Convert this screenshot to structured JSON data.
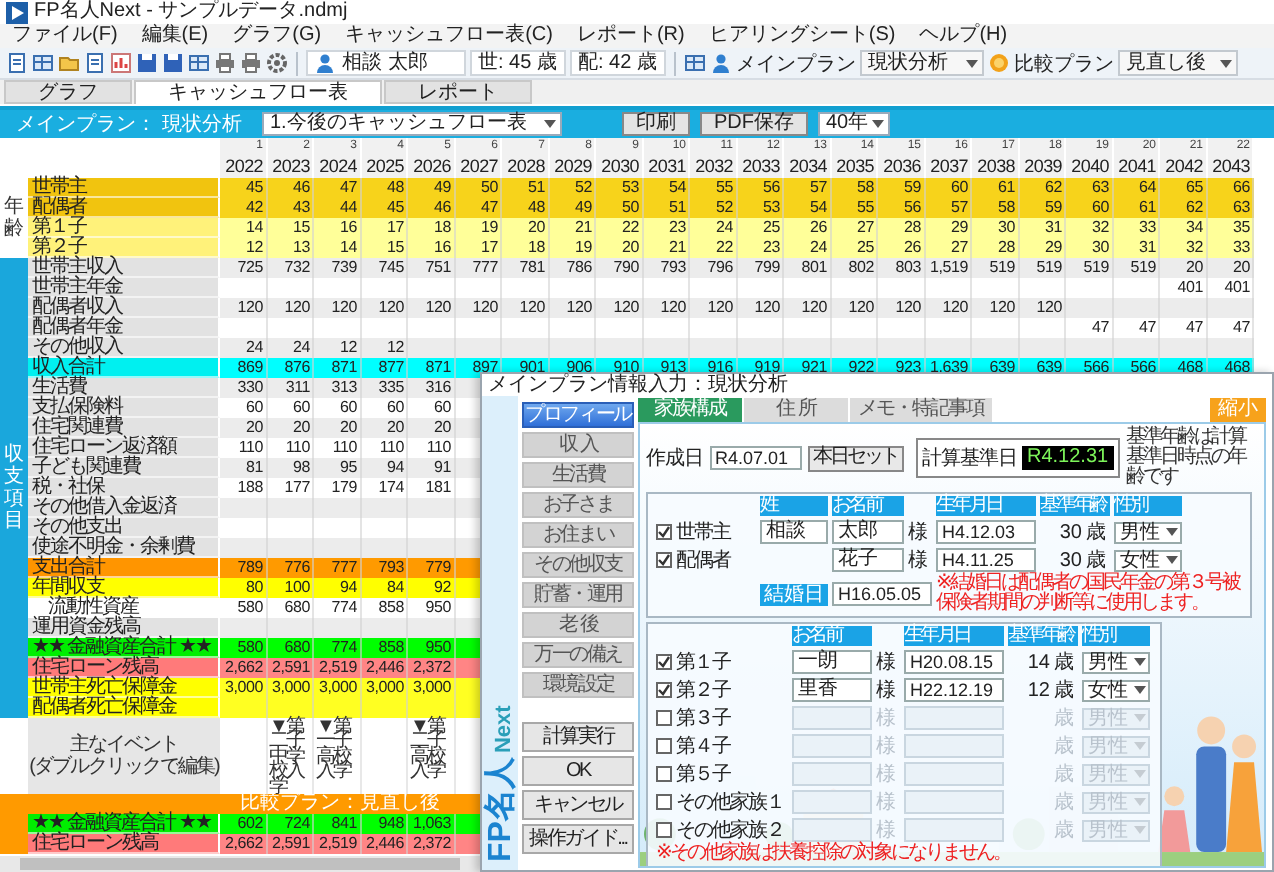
{
  "window": {
    "title": "FP名人Next - サンプルデータ.ndmj"
  },
  "menu": [
    "ファイル(F)",
    "編集(E)",
    "グラフ(G)",
    "キャッシュフロー表(C)",
    "レポート(R)",
    "ヒアリングシート(S)",
    "ヘルプ(H)"
  ],
  "toolbar": {
    "client": "相談 太郎",
    "head": {
      "label": "世:",
      "age": "45",
      "unit": "歳"
    },
    "spouse": {
      "label": "配:",
      "age": "42",
      "unit": "歳"
    },
    "main_plan": {
      "label": "メインプラン",
      "value": "現状分析"
    },
    "compare_plan": {
      "label": "比較プラン",
      "value": "見直し後"
    }
  },
  "tabs": [
    {
      "label": "グラフ",
      "selected": false
    },
    {
      "label": "キャッシュフロー表",
      "selected": true
    },
    {
      "label": "レポート",
      "selected": false
    }
  ],
  "plan_bar": {
    "title": "メインプラン： 現状分析",
    "report": "1.今後のキャッシュフロー表",
    "buttons": [
      "印刷",
      "PDF保存"
    ],
    "span": "40年"
  },
  "table": {
    "columns": [
      {
        "index": "1",
        "year": "2022"
      },
      {
        "index": "2",
        "year": "2023",
        "event": "▼第二子中学校入学"
      },
      {
        "index": "3",
        "year": "2024",
        "event": "▼第一子高校入学"
      },
      {
        "index": "4",
        "year": "2025"
      },
      {
        "index": "5",
        "year": "2026",
        "event": "▼第二子高校入学"
      },
      {
        "index": "6",
        "year": "2027"
      },
      {
        "index": "7",
        "year": "2028"
      },
      {
        "index": "8",
        "year": "2029"
      },
      {
        "index": "9",
        "year": "2030"
      },
      {
        "index": "10",
        "year": "2031"
      },
      {
        "index": "11",
        "year": "2032"
      },
      {
        "index": "12",
        "year": "2033"
      },
      {
        "index": "13",
        "year": "2034"
      },
      {
        "index": "14",
        "year": "2035"
      },
      {
        "index": "15",
        "year": "2036"
      },
      {
        "index": "16",
        "year": "2037"
      },
      {
        "index": "17",
        "year": "2038"
      },
      {
        "index": "18",
        "year": "2039"
      },
      {
        "index": "19",
        "year": "2040"
      },
      {
        "index": "20",
        "year": "2041"
      },
      {
        "index": "21",
        "year": "2042"
      },
      {
        "index": "22",
        "year": "2043"
      }
    ],
    "groups": [
      {
        "label": "年齢",
        "kind": "age",
        "rows": [
          {
            "label": "世帯主",
            "kind": "age_main",
            "values": [
              "45",
              "46",
              "47",
              "48",
              "49",
              "50",
              "51",
              "52",
              "53",
              "54",
              "55",
              "56",
              "57",
              "58",
              "59",
              "60",
              "61",
              "62",
              "63",
              "64",
              "65",
              "66"
            ]
          },
          {
            "label": "配偶者",
            "kind": "age_main",
            "values": [
              "42",
              "43",
              "44",
              "45",
              "46",
              "47",
              "48",
              "49",
              "50",
              "51",
              "52",
              "53",
              "54",
              "55",
              "56",
              "57",
              "58",
              "59",
              "60",
              "61",
              "62",
              "63"
            ]
          },
          {
            "label": "第１子",
            "kind": "age_child",
            "values": [
              "14",
              "15",
              "16",
              "17",
              "18",
              "19",
              "20",
              "21",
              "22",
              "23",
              "24",
              "25",
              "26",
              "27",
              "28",
              "29",
              "30",
              "31",
              "32",
              "33",
              "34",
              "35"
            ]
          },
          {
            "label": "第２子",
            "kind": "age_child",
            "values": [
              "12",
              "13",
              "14",
              "15",
              "16",
              "17",
              "18",
              "19",
              "20",
              "21",
              "22",
              "23",
              "24",
              "25",
              "26",
              "27",
              "28",
              "29",
              "30",
              "31",
              "32",
              "33"
            ]
          }
        ]
      },
      {
        "label": "収支項目",
        "kind": "cashflow",
        "rows": [
          {
            "label": "世帯主収入",
            "kind": "item",
            "values": [
              "725",
              "732",
              "739",
              "745",
              "751",
              "777",
              "781",
              "786",
              "790",
              "793",
              "796",
              "799",
              "801",
              "802",
              "803",
              "1,519",
              "519",
              "519",
              "519",
              "519",
              "20",
              "20"
            ]
          },
          {
            "label": "世帯主年金",
            "kind": "item_late",
            "values": [
              "401",
              "401"
            ]
          },
          {
            "label": "配偶者収入",
            "kind": "item",
            "values": [
              "120",
              "120",
              "120",
              "120",
              "120",
              "120",
              "120",
              "120",
              "120",
              "120",
              "120",
              "120",
              "120",
              "120",
              "120",
              "120",
              "120",
              "120"
            ]
          },
          {
            "label": "配偶者年金",
            "kind": "item_late",
            "values": [
              "47",
              "47",
              "47",
              "47"
            ]
          },
          {
            "label": "その他収入",
            "kind": "item",
            "values": [
              "24",
              "24",
              "12",
              "12"
            ]
          },
          {
            "label": "収入合計",
            "kind": "total_income",
            "values": [
              "869",
              "876",
              "871",
              "877",
              "871",
              "897",
              "901",
              "906",
              "910",
              "913",
              "916",
              "919",
              "921",
              "922",
              "923",
              "1,639",
              "639",
              "639",
              "566",
              "566",
              "468",
              "468"
            ]
          },
          {
            "label": "生活費",
            "kind": "item",
            "values": [
              "330",
              "311",
              "313",
              "335",
              "316"
            ]
          },
          {
            "label": "支払保険料",
            "kind": "item",
            "values": [
              "60",
              "60",
              "60",
              "60",
              "60"
            ]
          },
          {
            "label": "住宅関連費",
            "kind": "item",
            "values": [
              "20",
              "20",
              "20",
              "20",
              "20"
            ]
          },
          {
            "label": "住宅ローン返済額",
            "kind": "item",
            "values": [
              "110",
              "110",
              "110",
              "110",
              "110"
            ]
          },
          {
            "label": "子ども関連費",
            "kind": "item",
            "values": [
              "81",
              "98",
              "95",
              "94",
              "91"
            ]
          },
          {
            "label": "税・社保",
            "kind": "item",
            "values": [
              "188",
              "177",
              "179",
              "174",
              "181"
            ]
          },
          {
            "label": "その他借入金返済",
            "kind": "item"
          },
          {
            "label": "その他支出",
            "kind": "item"
          },
          {
            "label": "使途不明金・余剰費",
            "kind": "item"
          },
          {
            "label": "支出合計",
            "kind": "total_expense",
            "values": [
              "789",
              "776",
              "777",
              "793",
              "779"
            ]
          },
          {
            "label": "年間収支",
            "kind": "balance",
            "values": [
              "80",
              "100",
              "94",
              "84",
              "92"
            ]
          },
          {
            "label": "流動性資産",
            "kind": "sub",
            "values": [
              "580",
              "680",
              "774",
              "858",
              "950"
            ]
          },
          {
            "label": "運用資金残高",
            "kind": "item"
          },
          {
            "label": "★★ 金融資産合計 ★★",
            "kind": "assets",
            "values": [
              "580",
              "680",
              "774",
              "858",
              "950"
            ]
          },
          {
            "label": "住宅ローン残高",
            "kind": "loan",
            "values": [
              "2,662",
              "2,591",
              "2,519",
              "2,446",
              "2,372"
            ]
          },
          {
            "label": "世帯主死亡保障金",
            "kind": "insurance",
            "values": [
              "3,000",
              "3,000",
              "3,000",
              "3,000",
              "3,000"
            ]
          },
          {
            "label": "配偶者死亡保障金",
            "kind": "insurance"
          }
        ]
      }
    ],
    "events": {
      "label": [
        "主なイベント",
        "(ダブルクリックで編集)"
      ]
    },
    "comparison": {
      "label": "比較プラン：見直し後",
      "rows": [
        {
          "label": "★★ 金融資産合計 ★★",
          "kind": "assets",
          "values": [
            "602",
            "724",
            "841",
            "948",
            "1,063"
          ]
        },
        {
          "label": "住宅ローン残高",
          "kind": "loan",
          "values": [
            "2,662",
            "2,591",
            "2,519",
            "2,446",
            "2,372"
          ]
        }
      ]
    }
  },
  "dialog": {
    "title": "メインプラン情報入力：現状分析",
    "logo": "FP名人",
    "logo_suffix": "Next",
    "nav": [
      {
        "label": "プロフィール",
        "selected": true
      },
      {
        "label": "収 入",
        "selected": false
      },
      {
        "label": "生活費",
        "selected": false
      },
      {
        "label": "お子さま",
        "selected": false
      },
      {
        "label": "お住まい",
        "selected": false
      },
      {
        "label": "その他収支",
        "selected": false
      },
      {
        "label": "貯蓄・運用",
        "selected": false
      },
      {
        "label": "老 後",
        "selected": false
      },
      {
        "label": "万一の備え",
        "selected": false
      },
      {
        "label": "環境設定",
        "selected": false
      }
    ],
    "actions": [
      "計算実行",
      "OK",
      "キャンセル",
      "操作ガイド..."
    ],
    "tabs": [
      {
        "label": "家族構成",
        "selected": true
      },
      {
        "label": "住 所",
        "selected": false
      },
      {
        "label": "メモ・特記事項",
        "selected": false
      }
    ],
    "shrink": "縮小",
    "created": {
      "label": "作成日",
      "value": "R4.07.01",
      "button": "本日セット"
    },
    "base_date": {
      "label": "計算基準日",
      "value": "R4.12.31",
      "note": "基準年齢は計算基準日時点の年齢です"
    },
    "adults": {
      "headers": {
        "surname": "姓",
        "name": "お名前",
        "birth": "生年月日",
        "age": "基準年齢",
        "gender": "性別"
      },
      "rows": [
        {
          "role": "世帯主",
          "checked": true,
          "surname": "相談",
          "name": "太郎",
          "honorific": "様",
          "birth": "H4.12.03",
          "age": "30",
          "unit": "歳",
          "gender": "男性"
        },
        {
          "role": "配偶者",
          "checked": true,
          "name": "花子",
          "honorific": "様",
          "birth": "H4.11.25",
          "age": "30",
          "unit": "歳",
          "gender": "女性"
        }
      ],
      "marriage": {
        "label": "結婚日",
        "value": "H16.05.05"
      },
      "note": "※結婚日は配偶者の国民年金の第３号被保険者期間の判断等に使用します。"
    },
    "children": {
      "headers": {
        "name": "お名前",
        "birth": "生年月日",
        "age": "基準年齢",
        "gender": "性別"
      },
      "rows": [
        {
          "role": "第１子",
          "checked": true,
          "name": "一朗",
          "honorific": "様",
          "birth": "H20.08.15",
          "age": "14",
          "unit": "歳",
          "gender": "男性"
        },
        {
          "role": "第２子",
          "checked": true,
          "name": "里香",
          "honorific": "様",
          "birth": "H22.12.19",
          "age": "12",
          "unit": "歳",
          "gender": "女性"
        },
        {
          "role": "第３子",
          "checked": false,
          "honorific": "様",
          "unit": "歳",
          "gender": "男性"
        },
        {
          "role": "第４子",
          "checked": false,
          "honorific": "様",
          "unit": "歳",
          "gender": "男性"
        },
        {
          "role": "第５子",
          "checked": false,
          "honorific": "様",
          "unit": "歳",
          "gender": "男性"
        },
        {
          "role": "その他家族１",
          "checked": false,
          "honorific": "様",
          "unit": "歳",
          "gender": "男性"
        },
        {
          "role": "その他家族２",
          "checked": false,
          "honorific": "様",
          "unit": "歳",
          "gender": "男性"
        }
      ],
      "note": "※その他家族は扶養控除の対象になりません。"
    }
  }
}
